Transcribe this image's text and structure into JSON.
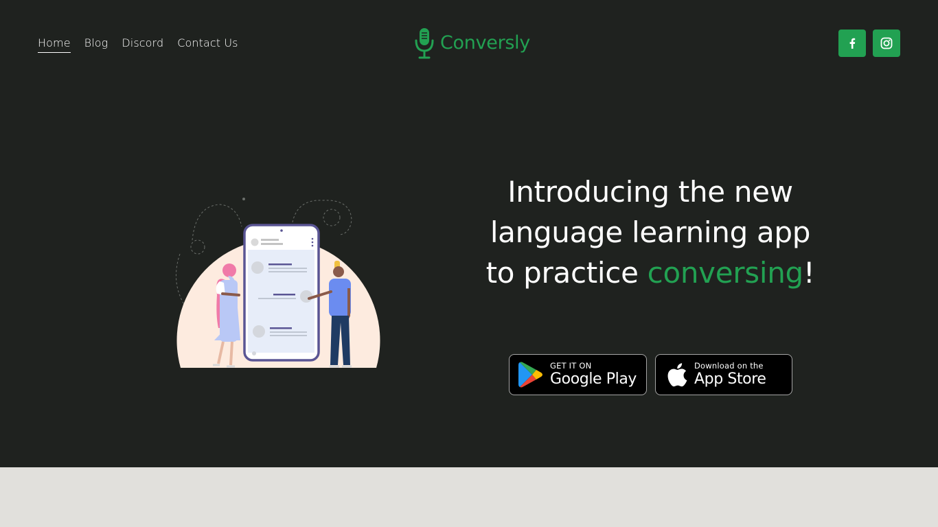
{
  "header": {
    "nav": {
      "home": "Home",
      "blog": "Blog",
      "discord": "Discord",
      "contact": "Contact Us"
    },
    "logo_text": "Conversly",
    "social": {
      "facebook_icon": "facebook-icon",
      "instagram_icon": "instagram-icon"
    }
  },
  "hero": {
    "headline_main": "Introducing the new language learning app to practice",
    "headline_accent": "conversing",
    "headline_end": "!",
    "illustration": "people-with-phone-chat-illustration",
    "google_play": {
      "small": "GET IT ON",
      "big": "Google Play"
    },
    "app_store": {
      "small": "Download on the",
      "big": "App Store"
    }
  },
  "colors": {
    "background": "#1f221f",
    "accent": "#22a152",
    "lower_section": "#e1e0dc",
    "text": "#ffffff"
  }
}
